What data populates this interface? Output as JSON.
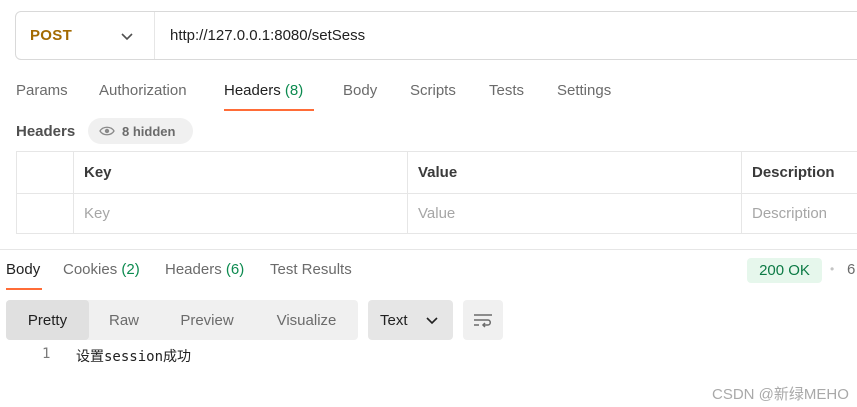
{
  "request": {
    "method": "POST",
    "url": "http://127.0.0.1:8080/setSess"
  },
  "request_tabs": [
    {
      "label": "Params"
    },
    {
      "label": "Authorization"
    },
    {
      "label": "Headers",
      "count": "(8)"
    },
    {
      "label": "Body"
    },
    {
      "label": "Scripts"
    },
    {
      "label": "Tests"
    },
    {
      "label": "Settings"
    }
  ],
  "headers": {
    "title": "Headers",
    "hidden_label": "8 hidden",
    "columns": {
      "key": "Key",
      "value": "Value",
      "description": "Description"
    },
    "placeholders": {
      "key": "Key",
      "value": "Value",
      "description": "Description"
    }
  },
  "response_tabs": [
    {
      "label": "Body"
    },
    {
      "label": "Cookies",
      "count": "(2)"
    },
    {
      "label": "Headers",
      "count": "(6)"
    },
    {
      "label": "Test Results"
    }
  ],
  "status": {
    "code_text": "200 OK",
    "dot": "•",
    "time_partial": "6"
  },
  "view_modes": [
    "Pretty",
    "Raw",
    "Preview",
    "Visualize"
  ],
  "format": "Text",
  "response_body": {
    "line_number": "1",
    "text": "设置session成功"
  },
  "watermark": "CSDN @新绿MEHO",
  "colors": {
    "method": "#a36a00",
    "accent": "#ff6c37",
    "count": "#0c8a4f",
    "status_bg": "#e6f7ec",
    "status_text": "#0c7a45"
  },
  "icons": [
    "chevron-down-icon",
    "eye-icon",
    "wrap-lines-icon"
  ]
}
